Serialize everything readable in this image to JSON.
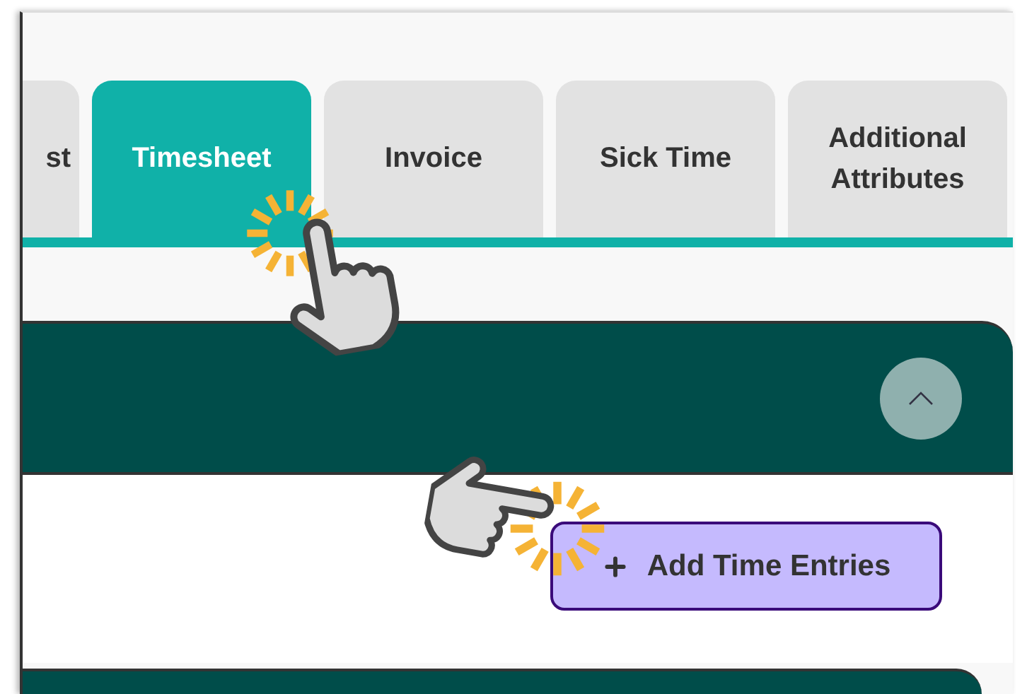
{
  "tabs": [
    {
      "label": "st",
      "selected": false
    },
    {
      "label": "Timesheet",
      "selected": true
    },
    {
      "label": "Invoice",
      "selected": false
    },
    {
      "label": "Sick Time",
      "selected": false
    },
    {
      "label": "Additional Attributes",
      "selected": false
    }
  ],
  "panel": {
    "expanded": true,
    "button": {
      "label": "Add Time Entries"
    }
  }
}
